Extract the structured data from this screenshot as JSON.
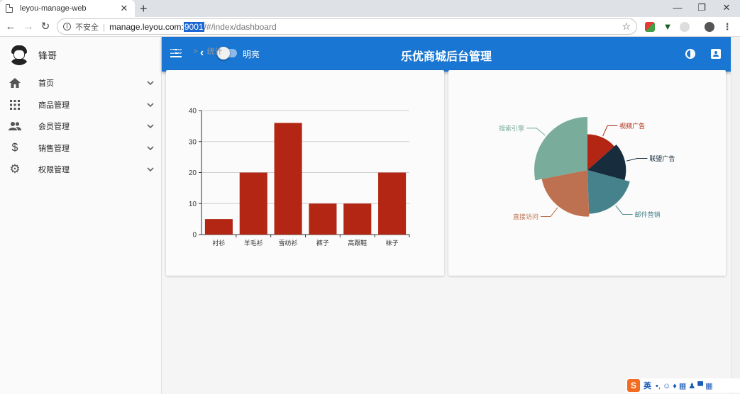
{
  "browser": {
    "tab_title": "leyou-manage-web",
    "tab_close": "✕",
    "new_tab": "+",
    "insecure_label": "不安全",
    "url_host": "manage.leyou.com:",
    "url_port": "9001",
    "url_path": "/#/index/dashboard"
  },
  "sidebar": {
    "username": "锋哥",
    "items": [
      {
        "label": "首页",
        "icon": "home-icon"
      },
      {
        "label": "商品管理",
        "icon": "apps-grid-icon"
      },
      {
        "label": "会员管理",
        "icon": "people-icon"
      },
      {
        "label": "销售管理",
        "icon": "dollar-icon"
      },
      {
        "label": "权限管理",
        "icon": "gear-icon"
      }
    ]
  },
  "appbar": {
    "theme_label": "明亮",
    "title": "乐优商城后台管理"
  },
  "breadcrumb": {
    "home": "首页",
    "separator": ">",
    "current": "统计"
  },
  "chart_data": [
    {
      "type": "bar",
      "categories": [
        "衬衫",
        "羊毛衫",
        "雪纺衫",
        "裤子",
        "高跟鞋",
        "袜子"
      ],
      "values": [
        5,
        20,
        36,
        10,
        10,
        20
      ],
      "ylim": [
        0,
        40
      ],
      "yticks": [
        0,
        10,
        20,
        30,
        40
      ],
      "grid": true,
      "color": "#b22613"
    },
    {
      "type": "pie",
      "rose": true,
      "slices": [
        {
          "name": "视频广告",
          "value": 12,
          "color": "#b22613"
        },
        {
          "name": "联盟广告",
          "value": 14,
          "color": "#172c3d"
        },
        {
          "name": "邮件营销",
          "value": 18,
          "color": "#45828c"
        },
        {
          "name": "直接访问",
          "value": 20,
          "color": "#bd7150"
        },
        {
          "name": "搜索引擎",
          "value": 25,
          "color": "#7aac9c"
        }
      ]
    }
  ],
  "ime": {
    "lang": "英",
    "icons": "•, ☺ ♦ ▦ ♟ ▀ ▦"
  }
}
